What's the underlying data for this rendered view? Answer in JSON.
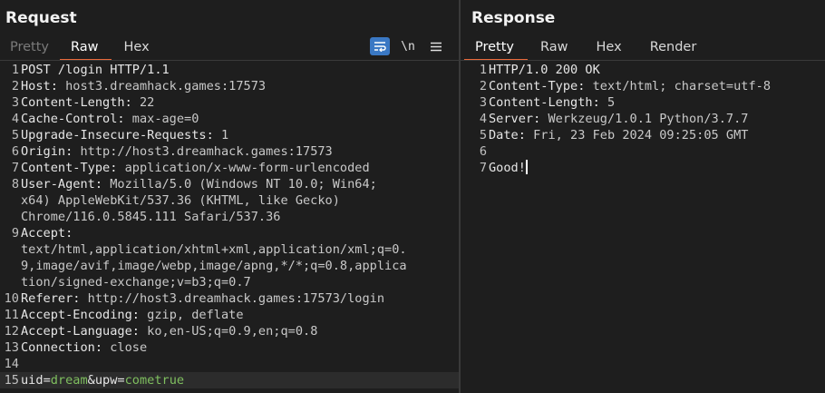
{
  "request": {
    "title": "Request",
    "tabs": [
      "Pretty",
      "Raw",
      "Hex"
    ],
    "active_tab": "Raw",
    "tools": {
      "wrap_icon": "word-wrap-icon",
      "newline_label": "\\n",
      "menu_icon": "hamburger-menu-icon"
    },
    "lines": [
      {
        "n": "1",
        "key": "POST /login HTTP/1.1",
        "val": ""
      },
      {
        "n": "2",
        "key": "Host: ",
        "val": "host3.dreamhack.games:17573"
      },
      {
        "n": "3",
        "key": "Content-Length: ",
        "val": "22"
      },
      {
        "n": "4",
        "key": "Cache-Control: ",
        "val": "max-age=0"
      },
      {
        "n": "5",
        "key": "Upgrade-Insecure-Requests: ",
        "val": "1"
      },
      {
        "n": "6",
        "key": "Origin: ",
        "val": "http://host3.dreamhack.games:17573"
      },
      {
        "n": "7",
        "key": "Content-Type: ",
        "val": "application/x-www-form-urlencoded"
      },
      {
        "n": "8",
        "key": "User-Agent: ",
        "val": "Mozilla/5.0 (Windows NT 10.0; Win64;"
      },
      {
        "n": "",
        "key": "",
        "val": "x64) AppleWebKit/537.36 (KHTML, like Gecko)"
      },
      {
        "n": "",
        "key": "",
        "val": "Chrome/116.0.5845.111 Safari/537.36"
      },
      {
        "n": "9",
        "key": "Accept:",
        "val": ""
      },
      {
        "n": "",
        "key": "",
        "val": "text/html,application/xhtml+xml,application/xml;q=0."
      },
      {
        "n": "",
        "key": "",
        "val": "9,image/avif,image/webp,image/apng,*/*;q=0.8,applica"
      },
      {
        "n": "",
        "key": "",
        "val": "tion/signed-exchange;v=b3;q=0.7"
      },
      {
        "n": "10",
        "key": "Referer: ",
        "val": "http://host3.dreamhack.games:17573/login"
      },
      {
        "n": "11",
        "key": "Accept-Encoding: ",
        "val": "gzip, deflate"
      },
      {
        "n": "12",
        "key": "Accept-Language: ",
        "val": "ko,en-US;q=0.9,en;q=0.8"
      },
      {
        "n": "13",
        "key": "Connection: ",
        "val": "close"
      },
      {
        "n": "14",
        "key": "",
        "val": ""
      }
    ],
    "body_line": {
      "n": "15",
      "param1_name": "uid",
      "eq1": "=",
      "param1_value": "dream",
      "amp": "&",
      "param2_name": "upw",
      "eq2": "=",
      "param2_value": "cometrue"
    }
  },
  "response": {
    "title": "Response",
    "tabs": [
      "Pretty",
      "Raw",
      "Hex",
      "Render"
    ],
    "active_tab": "Pretty",
    "lines": [
      {
        "n": "1",
        "key": "HTTP/1.0 200 OK",
        "val": ""
      },
      {
        "n": "2",
        "key": "Content-Type: ",
        "val": "text/html; charset=utf-8"
      },
      {
        "n": "3",
        "key": "Content-Length: ",
        "val": "5"
      },
      {
        "n": "4",
        "key": "Server: ",
        "val": "Werkzeug/1.0.1 Python/3.7.7"
      },
      {
        "n": "5",
        "key": "Date: ",
        "val": "Fri, 23 Feb 2024 09:25:05 GMT"
      },
      {
        "n": "6",
        "key": "",
        "val": ""
      }
    ],
    "body_line": {
      "n": "7",
      "text": "Good!"
    }
  },
  "colors": {
    "accent_tab": "#e8693b",
    "tool_active": "#3a78c4",
    "param_value": "#7fbf5f"
  }
}
